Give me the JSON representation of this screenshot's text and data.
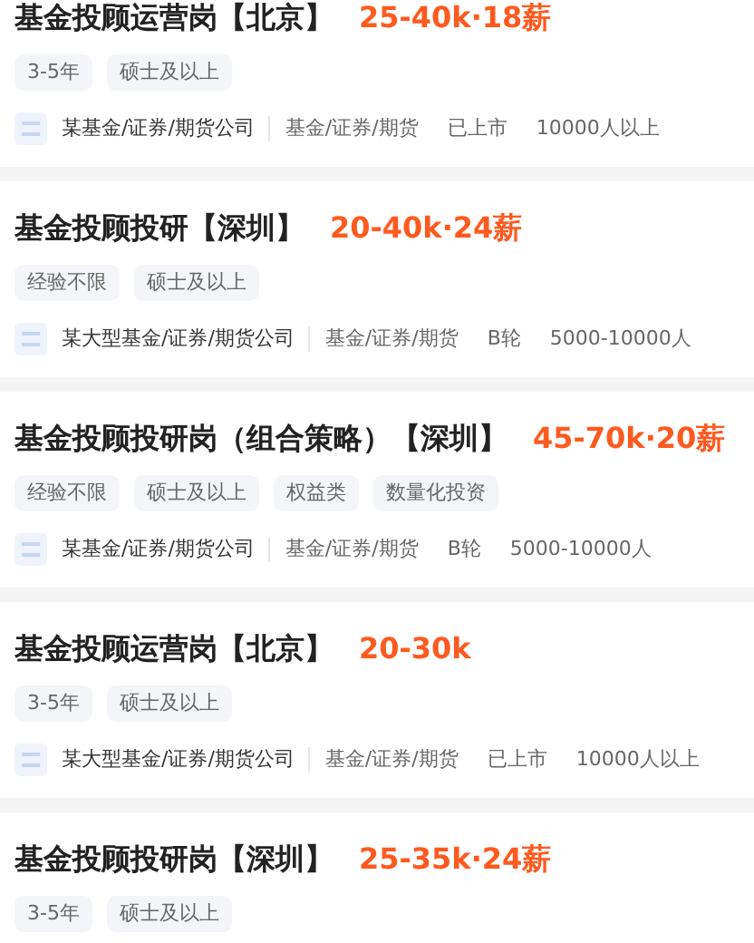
{
  "jobs": [
    {
      "title": "基金投顾运营岗【北京】",
      "salary": "25-40k·18薪",
      "tags": [
        "3-5年",
        "硕士及以上"
      ],
      "company": "某基金/证券/期货公司",
      "meta": [
        "基金/证券/期货",
        "已上市",
        "10000人以上"
      ]
    },
    {
      "title": "基金投顾投研【深圳】",
      "salary": "20-40k·24薪",
      "tags": [
        "经验不限",
        "硕士及以上"
      ],
      "company": "某大型基金/证券/期货公司",
      "meta": [
        "基金/证券/期货",
        "B轮",
        "5000-10000人"
      ]
    },
    {
      "title": "基金投顾投研岗（组合策略）【深圳】",
      "salary": "45-70k·20薪",
      "tags": [
        "经验不限",
        "硕士及以上",
        "权益类",
        "数量化投资"
      ],
      "company": "某基金/证券/期货公司",
      "meta": [
        "基金/证券/期货",
        "B轮",
        "5000-10000人"
      ]
    },
    {
      "title": "基金投顾运营岗【北京】",
      "salary": "20-30k",
      "tags": [
        "3-5年",
        "硕士及以上"
      ],
      "company": "某大型基金/证券/期货公司",
      "meta": [
        "基金/证券/期货",
        "已上市",
        "10000人以上"
      ]
    },
    {
      "title": "基金投顾投研岗【深圳】",
      "salary": "25-35k·24薪",
      "tags": [
        "3-5年",
        "硕士及以上"
      ]
    }
  ]
}
